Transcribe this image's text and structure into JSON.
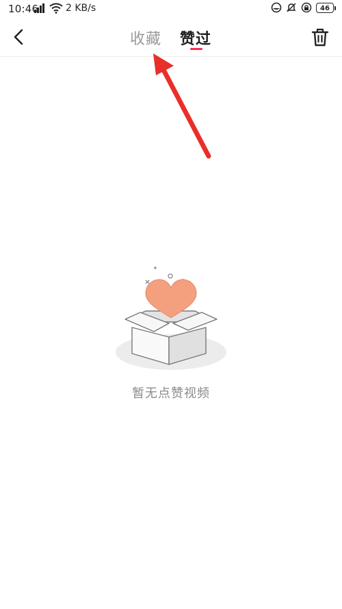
{
  "status_bar": {
    "time": "10:46",
    "network_speed": "2 KB/s",
    "battery": "46",
    "icons": [
      "signal-icon",
      "wifi-icon",
      "data-saver-icon",
      "mute-icon",
      "lock-icon",
      "battery-icon"
    ]
  },
  "header": {
    "back_icon": "chevron-left-icon",
    "tabs": [
      {
        "label": "收藏",
        "active": false
      },
      {
        "label": "赞过",
        "active": true
      }
    ],
    "delete_icon": "trash-icon"
  },
  "empty_state": {
    "illustration": "open-box-with-heart",
    "message": "暂无点赞视频"
  },
  "colors": {
    "accent": "#fe2c55",
    "annotation_arrow": "#e8302a",
    "heart": "#f4a07f",
    "text_inactive": "#9a9a9a",
    "text_empty": "#8a8a8a"
  }
}
